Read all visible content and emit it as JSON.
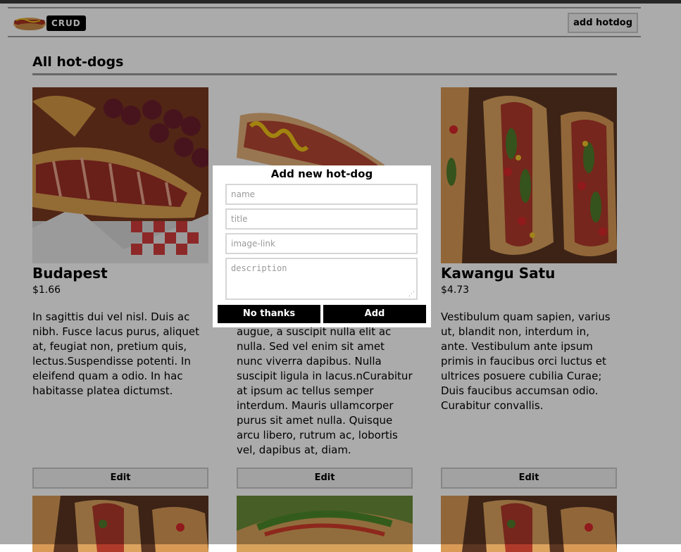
{
  "header": {
    "badge": "CRUD",
    "add_button": "add hotdog"
  },
  "section_title": "All hot-dogs",
  "cards": [
    {
      "name": "Budapest",
      "price": "$1.66",
      "description": "In sagittis dui vel nisl. Duis ac nibh. Fusce lacus purus, aliquet at, feugiat non, pretium quis, lectus.Suspendisse potenti. In eleifend quam a odio. In hac habitasse platea dictumst.",
      "edit_label": "Edit"
    },
    {
      "name": "",
      "price": "",
      "description": "pulvinar, nulla pede ullamcorper augue, a suscipit nulla elit ac nulla. Sed vel enim sit amet nunc viverra dapibus. Nulla suscipit ligula in lacus.nCurabitur at ipsum ac tellus semper interdum. Mauris ullamcorper purus sit amet nulla. Quisque arcu libero, rutrum ac, lobortis vel, dapibus at, diam.",
      "edit_label": "Edit"
    },
    {
      "name": "Kawangu Satu",
      "price": "$4.73",
      "description": "Vestibulum quam sapien, varius ut, blandit non, interdum in, ante. Vestibulum ante ipsum primis in faucibus orci luctus et ultrices posuere cubilia Curae; Duis faucibus accumsan odio. Curabitur convallis.",
      "edit_label": "Edit"
    }
  ],
  "modal": {
    "title": "Add new hot-dog",
    "name_placeholder": "name",
    "title_placeholder": "title",
    "image_placeholder": "image-link",
    "description_placeholder": "description",
    "cancel_label": "No thanks",
    "add_label": "Add"
  }
}
